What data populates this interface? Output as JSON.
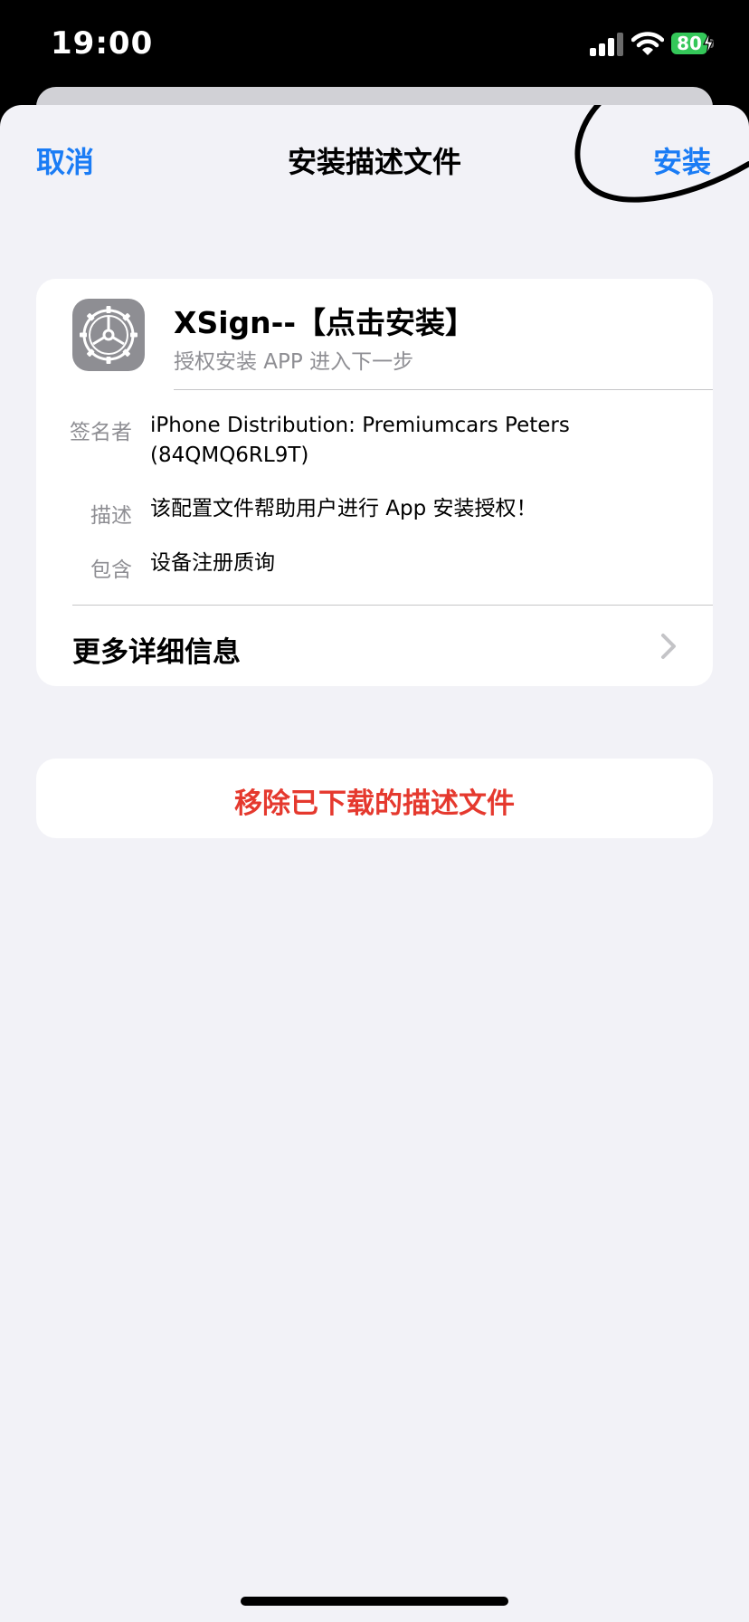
{
  "status_bar": {
    "time": "19:00",
    "battery_level": "80",
    "battery_color": "#34c759",
    "icons": [
      "cellular-signal-icon",
      "wifi-icon",
      "battery-charging-icon"
    ]
  },
  "nav": {
    "cancel_label": "取消",
    "title": "安装描述文件",
    "install_label": "安装",
    "accent_color": "#1a7cf5"
  },
  "profile": {
    "icon": "settings-gear-icon",
    "name": "XSign--【点击安装】",
    "subtitle": "授权安装 APP 进入下一步",
    "rows": [
      {
        "label": "签名者",
        "value": "iPhone Distribution: Premiumcars Peters (84QMQ6RL9T)"
      },
      {
        "label": "描述",
        "value": "该配置文件帮助用户进行 App 安装授权！"
      },
      {
        "label": "包含",
        "value": "设备注册质询"
      }
    ],
    "more_details_label": "更多详细信息"
  },
  "remove": {
    "label": "移除已下载的描述文件",
    "color": "#e5392e"
  }
}
